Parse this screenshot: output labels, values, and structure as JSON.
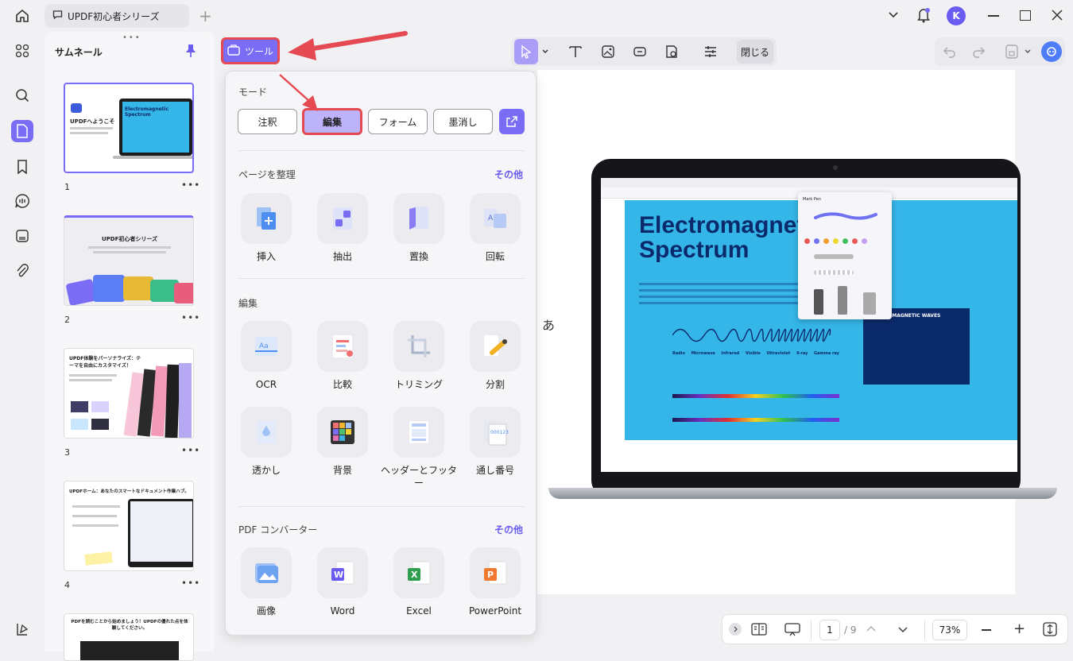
{
  "window": {
    "tab_title": "UPDF初心者シリーズ",
    "avatar_letter": "K"
  },
  "sidebar": {
    "panel_title": "サムネール"
  },
  "thumbnails": [
    {
      "num": "1",
      "heading": "UPDFへようこそ",
      "doc_title": "Electromagnetic Spectrum"
    },
    {
      "num": "2",
      "heading": "UPDF初心者シリーズ"
    },
    {
      "num": "3",
      "heading": "UPDF体験をパーソナライズ：テーマを自由にカスタマイズ！"
    },
    {
      "num": "4",
      "heading": "UPDFホーム：あなたのスマートなドキュメント作業ハブ。"
    },
    {
      "num": "",
      "heading": "PDFを読むことから始めましょう！UPDFの優れた点を体験してください。"
    }
  ],
  "toolbar": {
    "tools_label": "ツール",
    "close_label": "閉じる"
  },
  "popover": {
    "mode_title": "モード",
    "modes": [
      "注釈",
      "編集",
      "フォーム",
      "墨消し"
    ],
    "organize": {
      "title": "ページを整理",
      "more": "その他",
      "items": [
        "挿入",
        "抽出",
        "置換",
        "回転"
      ]
    },
    "edit": {
      "title": "編集",
      "items": [
        "OCR",
        "比較",
        "トリミング",
        "分割",
        "透かし",
        "背景",
        "ヘッダーとフッター",
        "通し番号"
      ]
    },
    "converter": {
      "title": "PDF コンバーター",
      "more": "その他",
      "items": [
        "画像",
        "Word",
        "Excel",
        "PowerPoint"
      ]
    }
  },
  "document": {
    "ime_char": "あ",
    "screen_title": "Electromagnetic Spectrum",
    "mark_pen": "Mark Pen",
    "waves_label": "ELECTROMAGNETIC WAVES",
    "bands": [
      "Radio",
      "Microwave",
      "Infrared",
      "Visible",
      "Ultraviolet",
      "X-ray",
      "Gamma ray"
    ]
  },
  "bottombar": {
    "page_current": "1",
    "page_total": "/ 9",
    "zoom": "73%"
  },
  "colors": {
    "accent": "#7b6cf6",
    "highlight_red": "#e54a52",
    "doc_blue": "#1aa3e0"
  }
}
